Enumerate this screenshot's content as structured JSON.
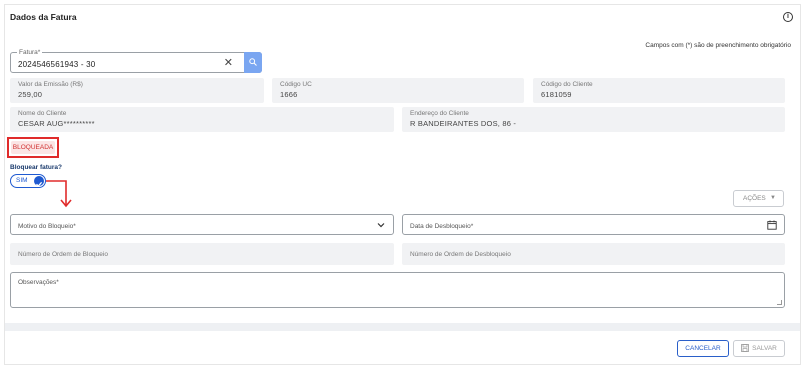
{
  "header": {
    "title": "Dados da Fatura",
    "info_icon": "i",
    "required_note": "Campos com (*) são de preenchimento obrigatório"
  },
  "fatura": {
    "label": "Fatura*",
    "value": "2024546561943 - 30",
    "clear_symbol": "✕"
  },
  "info_fields": {
    "valor_emissao": {
      "label": "Valor da Emissão (R$)",
      "value": "259,00"
    },
    "codigo_uc": {
      "label": "Código UC",
      "value": "1666"
    },
    "codigo_cliente": {
      "label": "Código do Cliente",
      "value": "6181059"
    },
    "nome_cliente": {
      "label": "Nome do Cliente",
      "value": "CESAR AUG**********"
    },
    "endereco_cliente": {
      "label": "Endereço do Cliente",
      "value": "R BANDEIRANTES DOS, 86 -"
    }
  },
  "status": {
    "badge": "BLOQUEADA",
    "highlight_color": "#e02b2b"
  },
  "bloquear": {
    "label": "Bloquear fatura?",
    "toggle_label": "SIM",
    "checked": true
  },
  "acoes": {
    "label": "AÇÕES",
    "caret": "▼"
  },
  "form": {
    "motivo_bloqueio": {
      "label": "Motivo do Bloqueio*"
    },
    "data_desbloqueio": {
      "label": "Data de Desbloqueio*"
    },
    "ordem_bloqueio": {
      "label": "Número de Ordem de Bloqueio"
    },
    "ordem_desbloqueio": {
      "label": "Número de Ordem de Desbloqueio"
    },
    "observacoes": {
      "label": "Observações*"
    }
  },
  "footer": {
    "cancel_label": "CANCELAR",
    "save_label": "SALVAR"
  },
  "colors": {
    "primary": "#1f5ad1",
    "search_button": "#7aa6f1",
    "filled_bg": "#f1f2f4",
    "alert_red": "#e02b2b"
  },
  "icons": [
    "info-icon",
    "clear-icon",
    "search-icon",
    "check-icon",
    "chevron-down-icon",
    "calendar-icon",
    "save-icon",
    "arrow-annotation"
  ]
}
